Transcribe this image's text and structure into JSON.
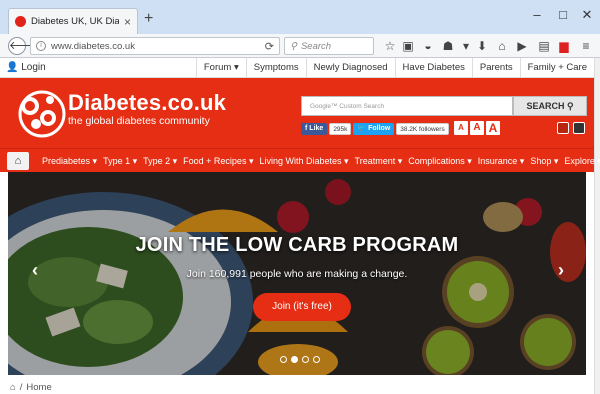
{
  "browser": {
    "tab_title": "Diabetes UK, UK Diabetes ...",
    "tab_close": "×",
    "new_tab": "+",
    "url": "www.diabetes.co.uk",
    "search_placeholder": "Search",
    "win_min": "–",
    "win_max": "□",
    "win_close": "✕"
  },
  "site": {
    "login": "Login",
    "top_links": [
      "Forum ▾",
      "Symptoms",
      "Newly Diagnosed",
      "Have Diabetes",
      "Parents",
      "Family + Care"
    ],
    "brand": "Diabetes.co.uk",
    "tagline": "the global diabetes community",
    "search_placeholder": "Google™ Custom Search",
    "search_button": "SEARCH",
    "facebook_label": "Like",
    "facebook_count": "295k",
    "twitter_label": "Follow",
    "twitter_count": "38.2K followers",
    "font_sizes": [
      "A",
      "A",
      "A"
    ],
    "nav": [
      "Prediabetes ▾",
      "Type 1 ▾",
      "Type 2 ▾",
      "Food + Recipes ▾",
      "Living With Diabetes ▾",
      "Treatment ▾",
      "Complications ▾",
      "Insurance ▾",
      "Shop ▾",
      "Explore ▾"
    ]
  },
  "hero": {
    "title": "JOIN THE LOW CARB PROGRAM",
    "subtitle": "Join 160,991 people who are making a change.",
    "button": "Join (it's free)",
    "active_slide": 2,
    "slide_count": 4
  },
  "breadcrumb": {
    "home": "Home"
  },
  "colors": {
    "brand_red": "#e62e14",
    "facebook": "#3b5998",
    "twitter": "#1da1f2"
  }
}
